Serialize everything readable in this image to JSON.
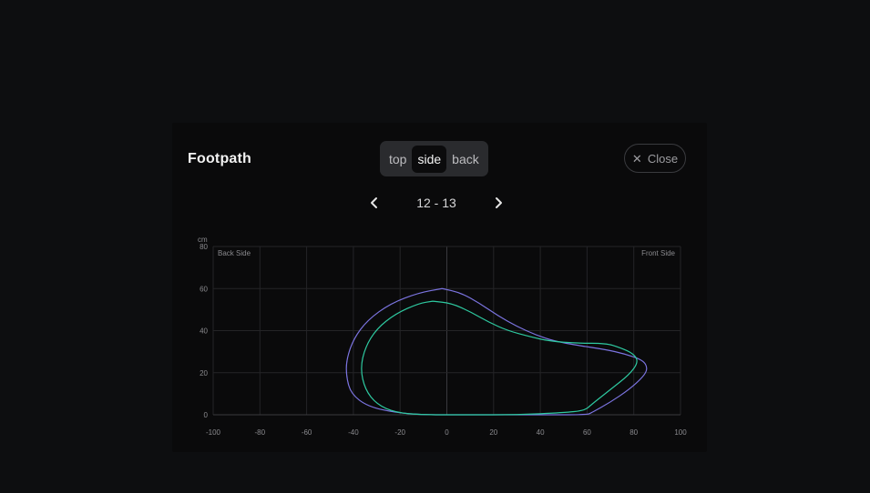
{
  "panel": {
    "title": "Footpath",
    "views": [
      {
        "label": "top",
        "active": false
      },
      {
        "label": "side",
        "active": true
      },
      {
        "label": "back",
        "active": false
      }
    ],
    "close_label": "Close",
    "close_icon": "close-icon",
    "pager": {
      "prev_icon": "chevron-left-icon",
      "range": "12 - 13",
      "next_icon": "chevron-right-icon"
    }
  },
  "chart_data": {
    "type": "line",
    "ylabel": "cm",
    "xlim": [
      -100,
      100
    ],
    "ylim": [
      0,
      80
    ],
    "x_ticks": [
      -100,
      -80,
      -60,
      -40,
      -20,
      0,
      20,
      40,
      60,
      80,
      100
    ],
    "y_ticks": [
      0,
      20,
      40,
      60,
      80
    ],
    "x_tick_labels": [
      "-100",
      "-80",
      "-60",
      "-40",
      "-20",
      "0",
      "20",
      "40",
      "60",
      "80",
      "100"
    ],
    "y_tick_labels": [
      "0",
      "20",
      "40",
      "60",
      "80"
    ],
    "grid": true,
    "annotations": {
      "left": "Back Side",
      "right": "Front Side"
    },
    "series": [
      {
        "color": "#7b74e0",
        "points": [
          [
            -2,
            60
          ],
          [
            6,
            58
          ],
          [
            14,
            53
          ],
          [
            22,
            47
          ],
          [
            30,
            42
          ],
          [
            38,
            38
          ],
          [
            46,
            35
          ],
          [
            56,
            33
          ],
          [
            68,
            31
          ],
          [
            76,
            29
          ],
          [
            84,
            26
          ],
          [
            86,
            22
          ],
          [
            84,
            18
          ],
          [
            78,
            12
          ],
          [
            70,
            6
          ],
          [
            62,
            1
          ],
          [
            60,
            0
          ],
          [
            40,
            0
          ],
          [
            10,
            0
          ],
          [
            -10,
            0
          ],
          [
            -22,
            1
          ],
          [
            -34,
            4
          ],
          [
            -41,
            10
          ],
          [
            -43,
            18
          ],
          [
            -43,
            26
          ],
          [
            -40,
            36
          ],
          [
            -34,
            45
          ],
          [
            -24,
            53
          ],
          [
            -12,
            58
          ],
          [
            -2,
            60
          ]
        ]
      },
      {
        "color": "#2ec9a0",
        "points": [
          [
            -6,
            54
          ],
          [
            2,
            53
          ],
          [
            10,
            49
          ],
          [
            18,
            44
          ],
          [
            26,
            40
          ],
          [
            36,
            37
          ],
          [
            44,
            35
          ],
          [
            56,
            34
          ],
          [
            68,
            34
          ],
          [
            74,
            32
          ],
          [
            80,
            29
          ],
          [
            82,
            25
          ],
          [
            78,
            19
          ],
          [
            70,
            12
          ],
          [
            62,
            5
          ],
          [
            59,
            2
          ],
          [
            50,
            1
          ],
          [
            30,
            0
          ],
          [
            10,
            0
          ],
          [
            -10,
            0
          ],
          [
            -22,
            1
          ],
          [
            -30,
            5
          ],
          [
            -35,
            12
          ],
          [
            -37,
            22
          ],
          [
            -35,
            32
          ],
          [
            -30,
            41
          ],
          [
            -22,
            48
          ],
          [
            -12,
            53
          ],
          [
            -6,
            54
          ]
        ]
      }
    ]
  }
}
